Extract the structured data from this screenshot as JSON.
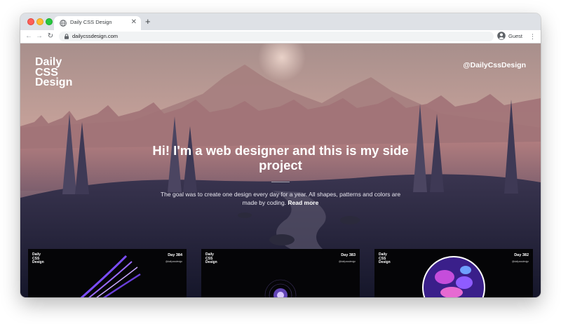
{
  "browser": {
    "tab_title": "Daily CSS Design",
    "tab_close": "✕",
    "new_tab": "+",
    "url": "dailycssdesign.com",
    "profile_label": "Guest",
    "nav": {
      "back": "←",
      "forward": "→",
      "reload": "↻",
      "menu": "⋮"
    }
  },
  "site": {
    "logo_lines": [
      "Daily",
      "CSS",
      "Design"
    ],
    "handle": "@DailyCssDesign",
    "headline": "Hi! I'm a web designer and this is my side project",
    "intro": "The goal was to create one design every day for a year. All shapes, patterns and colors are made by coding.",
    "read_more": "Read more"
  },
  "cards": [
    {
      "logo_lines": [
        "Daily",
        "CSS",
        "Design"
      ],
      "day": "Day 384",
      "handle": "@dailycssdesign"
    },
    {
      "logo_lines": [
        "Daily",
        "CSS",
        "Design"
      ],
      "day": "Day 383",
      "handle": "@dailycssdesign"
    },
    {
      "logo_lines": [
        "Daily",
        "CSS",
        "Design"
      ],
      "day": "Day 382",
      "handle": "@dailycssdesign"
    }
  ],
  "colors": {
    "traffic_red": "#fe5f57",
    "traffic_yellow": "#febc2e",
    "traffic_green": "#28c840",
    "sky_top": "#a48f8e",
    "sky_bottom": "#c49b94",
    "forest_dark": "#2a2a40"
  },
  "icons": [
    "globe-icon",
    "lock-icon",
    "avatar-icon",
    "back-arrow-icon",
    "forward-arrow-icon",
    "reload-icon",
    "menu-icon"
  ]
}
